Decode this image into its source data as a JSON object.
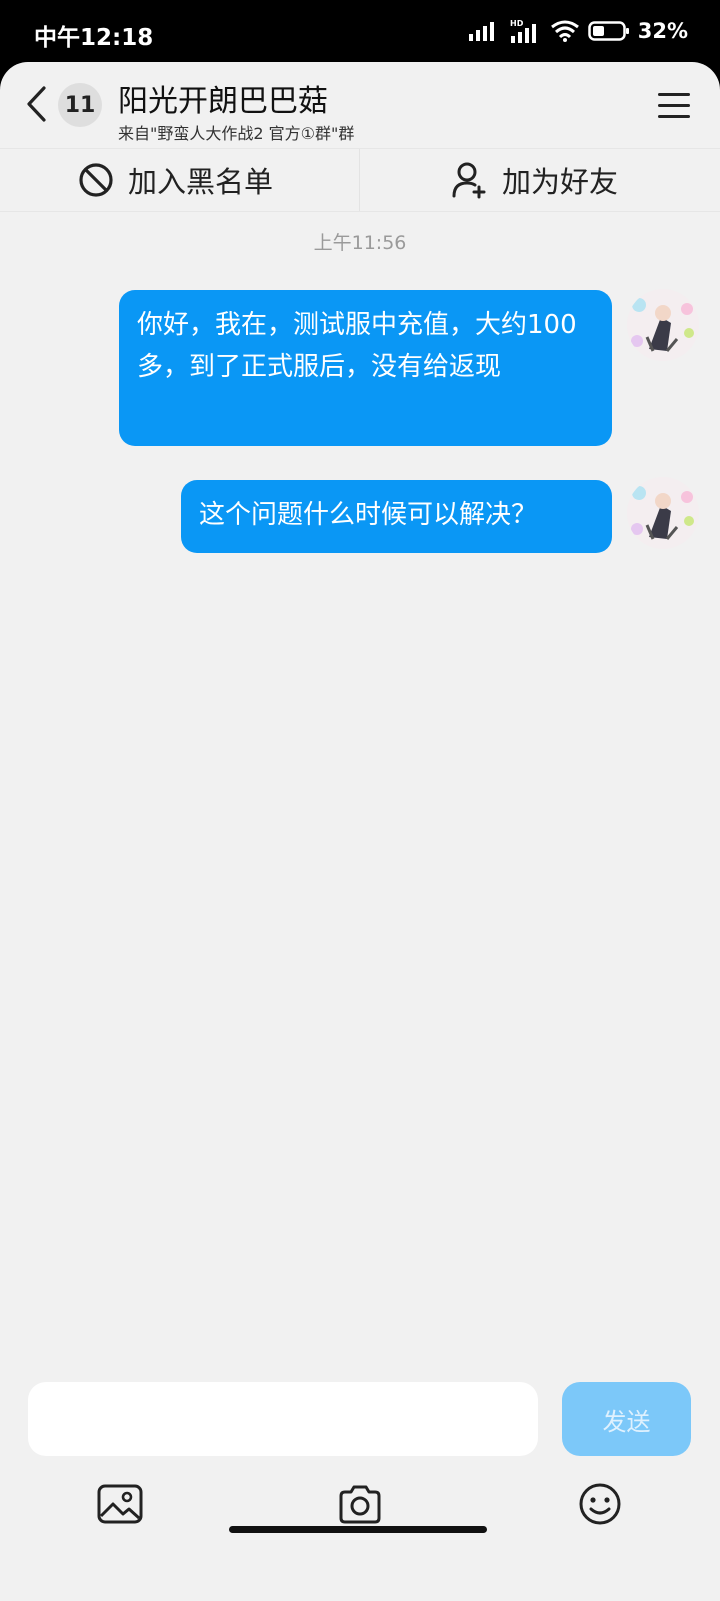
{
  "status_bar": {
    "time": "中午12:18",
    "battery": "32%",
    "network_label": "HD"
  },
  "header": {
    "unread_count": "11",
    "title": "阳光开朗巴巴菇",
    "subtitle": "来自\"野蛮人大作战2 官方①群\"群"
  },
  "actions": {
    "blacklist_label": "加入黑名单",
    "add_friend_label": "加为好友"
  },
  "conversation": {
    "timestamp": "上午11:56",
    "messages": [
      {
        "text": "你好，我在，测试服中充值，大约100多，到了正式服后，没有给返现"
      },
      {
        "text": "这个问题什么时候可以解决？"
      }
    ]
  },
  "composer": {
    "input_value": "",
    "send_label": "发送"
  },
  "colors": {
    "bubble": "#0a97f5",
    "send_button": "#7cc8f9",
    "background": "#f1f1f1"
  },
  "icons": [
    "back-arrow-icon",
    "menu-icon",
    "block-icon",
    "add-user-icon",
    "image-icon",
    "camera-icon",
    "emoji-icon"
  ]
}
